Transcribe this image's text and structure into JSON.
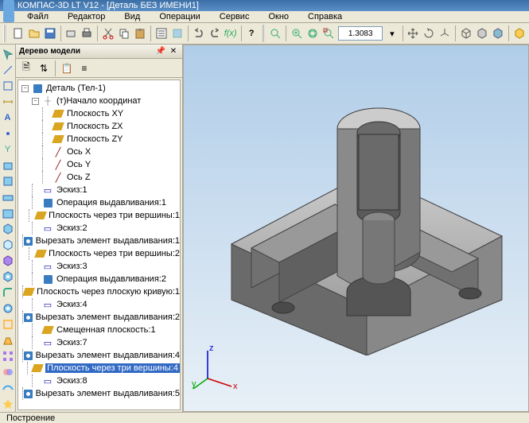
{
  "title": "КОМПАС-3D LT V12 - [Деталь БЕЗ ИМЕНИ1]",
  "menu": [
    "Файл",
    "Редактор",
    "Вид",
    "Операции",
    "Сервис",
    "Окно",
    "Справка"
  ],
  "zoom": "1.3083",
  "tree": {
    "title": "Дерево модели",
    "root": "Деталь (Тел-1)",
    "origin": "(т)Начало координат",
    "items": [
      {
        "label": "Плоскость XY",
        "icon": "plane",
        "indent": 2
      },
      {
        "label": "Плоскость ZX",
        "icon": "plane",
        "indent": 2
      },
      {
        "label": "Плоскость ZY",
        "icon": "plane",
        "indent": 2
      },
      {
        "label": "Ось X",
        "icon": "axis",
        "indent": 2
      },
      {
        "label": "Ось Y",
        "icon": "axis",
        "indent": 2
      },
      {
        "label": "Ось Z",
        "icon": "axis",
        "indent": 2
      },
      {
        "label": "Эскиз:1",
        "icon": "sketch",
        "indent": 1
      },
      {
        "label": "Операция выдавливания:1",
        "icon": "op",
        "indent": 1
      },
      {
        "label": "Плоскость через три вершины:1",
        "icon": "plane",
        "indent": 1
      },
      {
        "label": "Эскиз:2",
        "icon": "sketch",
        "indent": 1
      },
      {
        "label": "Вырезать элемент выдавливания:1",
        "icon": "cut",
        "indent": 1
      },
      {
        "label": "Плоскость через три вершины:2",
        "icon": "plane",
        "indent": 1
      },
      {
        "label": "Эскиз:3",
        "icon": "sketch",
        "indent": 1
      },
      {
        "label": "Операция выдавливания:2",
        "icon": "op",
        "indent": 1
      },
      {
        "label": "Плоскость через плоскую кривую:1",
        "icon": "plane",
        "indent": 1
      },
      {
        "label": "Эскиз:4",
        "icon": "sketch",
        "indent": 1
      },
      {
        "label": "Вырезать элемент выдавливания:2",
        "icon": "cut",
        "indent": 1
      },
      {
        "label": "Смещенная плоскость:1",
        "icon": "plane",
        "indent": 1
      },
      {
        "label": "Эскиз:7",
        "icon": "sketch",
        "indent": 1
      },
      {
        "label": "Вырезать элемент выдавливания:4",
        "icon": "cut",
        "indent": 1
      },
      {
        "label": "Плоскость через три вершины:4",
        "icon": "plane",
        "indent": 1,
        "sel": true
      },
      {
        "label": "Эскиз:8",
        "icon": "sketch",
        "indent": 1
      },
      {
        "label": "Вырезать элемент выдавливания:5",
        "icon": "cut",
        "indent": 1
      }
    ]
  },
  "axis_labels": {
    "x": "x",
    "y": "y",
    "z": "z"
  },
  "status": "Построение"
}
